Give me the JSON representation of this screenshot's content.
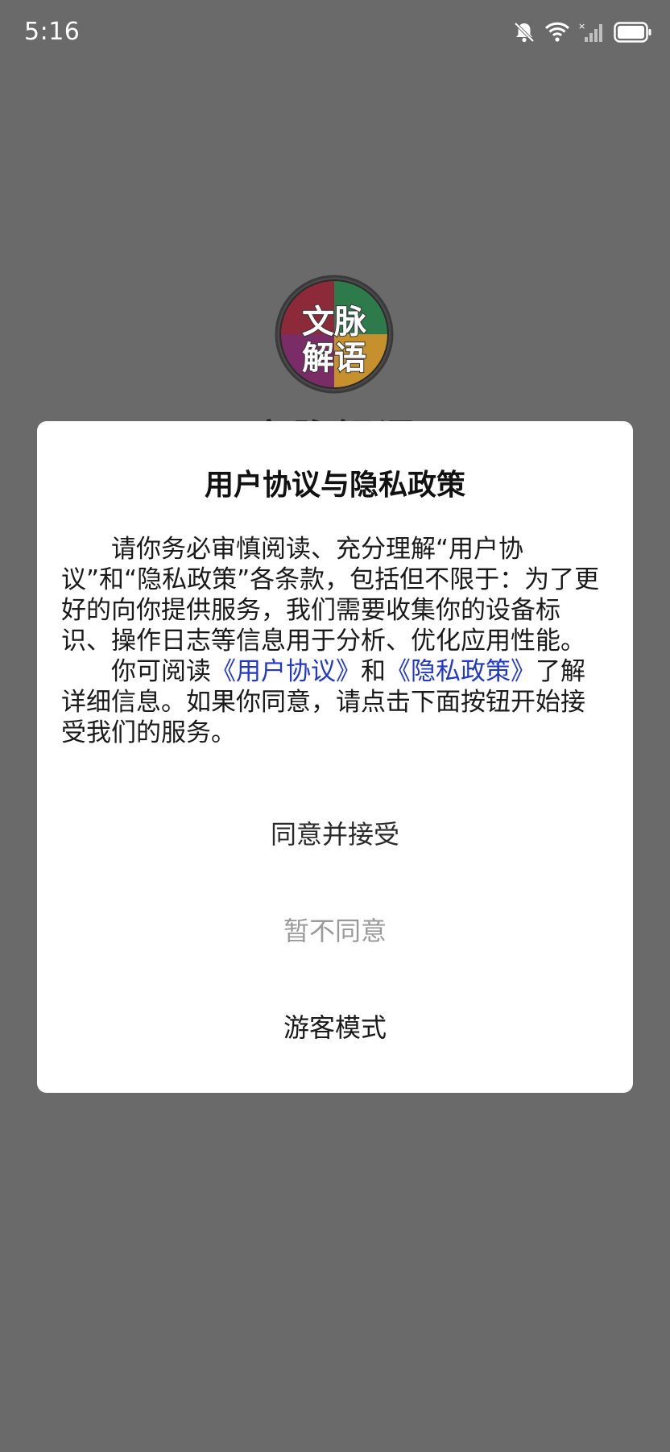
{
  "status_bar": {
    "time": "5:16",
    "icons": [
      "bell-muted-icon",
      "wifi-icon",
      "no-signal-icon",
      "battery-icon"
    ]
  },
  "splash": {
    "logo_text": "文脉解语",
    "logo_line1": "文脉",
    "logo_line2": "解语",
    "app_name": "文脉解语"
  },
  "dialog": {
    "title": "用户协议与隐私政策",
    "paragraph1": "请你务必审慎阅读、充分理解“用户协议”和“隐私政策”各条款，包括但不限于：为了更好的向你提供服务，我们需要收集你的设备标识、操作日志等信息用于分析、优化应用性能。",
    "paragraph2_prefix": "你可阅读",
    "user_agreement_link": "《用户协议》",
    "paragraph2_and": "和",
    "privacy_policy_link": "《隐私政策》",
    "paragraph2_suffix": "了解详细信息。如果你同意，请点击下面按钮开始接受我们的服务。",
    "agree_button": "同意并接受",
    "disagree_button": "暂不同意",
    "guest_button": "游客模式"
  },
  "colors": {
    "overlay": "#6a6a6a",
    "link": "#2238c9",
    "disabled_text": "#9a9a9a"
  }
}
